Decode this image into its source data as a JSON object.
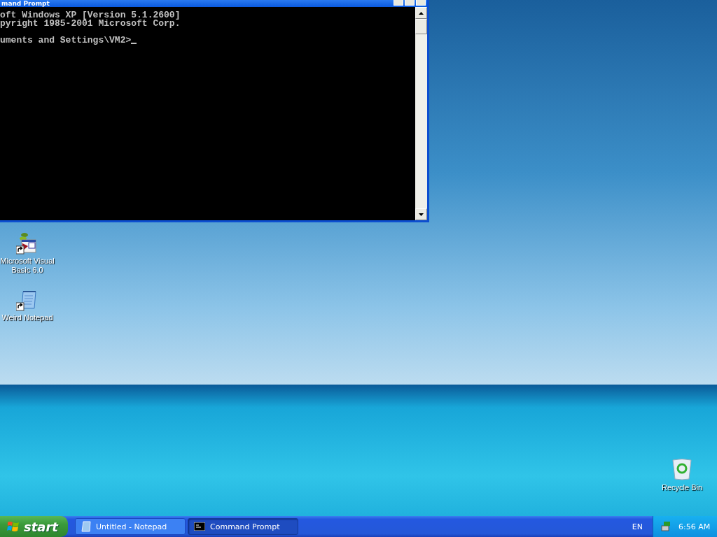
{
  "console_window": {
    "title": "mand Prompt",
    "output": [
      "oft Windows XP [Version 5.1.2600]",
      "pyright 1985-2001 Microsoft Corp."
    ],
    "prompt": "uments and Settings\\VM2>"
  },
  "desktop_icons": [
    {
      "label": "Microsoft Visual Basic 6.0",
      "kind": "vb",
      "shortcut": true
    },
    {
      "label": "Weird Notepad",
      "kind": "notepad",
      "shortcut": true
    }
  ],
  "recycle_bin": {
    "label": "Recycle Bin"
  },
  "taskbar": {
    "start": "start",
    "tasks": [
      {
        "label": "Untitled - Notepad",
        "kind": "notepad",
        "selected": false
      },
      {
        "label": "Command Prompt",
        "kind": "cmd",
        "selected": true
      }
    ],
    "language": "EN",
    "clock": "6:56 AM"
  }
}
